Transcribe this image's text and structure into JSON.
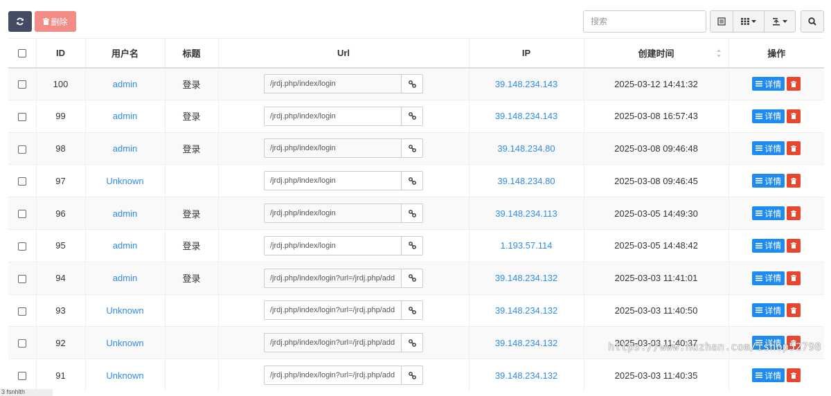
{
  "toolbar": {
    "delete_label": "删除",
    "search_placeholder": "搜索"
  },
  "table": {
    "headers": [
      "ID",
      "用户名",
      "标题",
      "Url",
      "IP",
      "创建时间",
      "操作"
    ],
    "detail_label": "详情",
    "rows": [
      {
        "id": "100",
        "username": "admin",
        "title": "登录",
        "url": "/jrdj.php/index/login",
        "ip": "39.148.234.143",
        "created": "2025-03-12 14:41:32"
      },
      {
        "id": "99",
        "username": "admin",
        "title": "登录",
        "url": "/jrdj.php/index/login",
        "ip": "39.148.234.143",
        "created": "2025-03-08 16:57:43"
      },
      {
        "id": "98",
        "username": "admin",
        "title": "登录",
        "url": "/jrdj.php/index/login",
        "ip": "39.148.234.80",
        "created": "2025-03-08 09:46:48"
      },
      {
        "id": "97",
        "username": "Unknown",
        "title": "",
        "url": "/jrdj.php/index/login",
        "ip": "39.148.234.80",
        "created": "2025-03-08 09:46:45"
      },
      {
        "id": "96",
        "username": "admin",
        "title": "登录",
        "url": "/jrdj.php/index/login",
        "ip": "39.148.234.113",
        "created": "2025-03-05 14:49:30"
      },
      {
        "id": "95",
        "username": "admin",
        "title": "登录",
        "url": "/jrdj.php/index/login",
        "ip": "1.193.57.114",
        "created": "2025-03-05 14:48:42"
      },
      {
        "id": "94",
        "username": "admin",
        "title": "登录",
        "url": "/jrdj.php/index/login?url=/jrdj.php/add",
        "ip": "39.148.234.132",
        "created": "2025-03-03 11:41:01"
      },
      {
        "id": "93",
        "username": "Unknown",
        "title": "",
        "url": "/jrdj.php/index/login?url=/jrdj.php/add",
        "ip": "39.148.234.132",
        "created": "2025-03-03 11:40:50"
      },
      {
        "id": "92",
        "username": "Unknown",
        "title": "",
        "url": "/jrdj.php/index/login?url=/jrdj.php/add",
        "ip": "39.148.234.132",
        "created": "2025-03-03 11:40:37"
      },
      {
        "id": "91",
        "username": "Unknown",
        "title": "",
        "url": "/jrdj.php/index/login?url=/jrdj.php/add",
        "ip": "39.148.234.132",
        "created": "2025-03-03 11:40:35"
      }
    ]
  },
  "watermark": "https://www.huzhan.com/ishop52798",
  "statusbar": "3 fsnhlth"
}
